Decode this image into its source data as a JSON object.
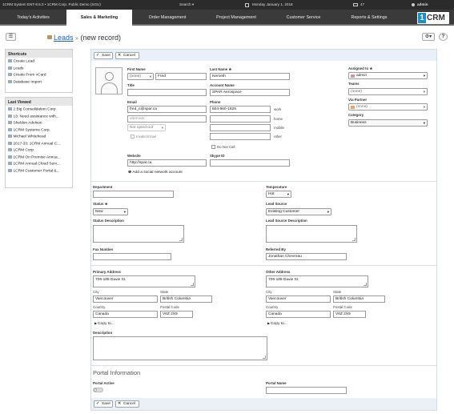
{
  "topbar": {
    "system": "1CRM System ENT-8.6.0 • 1CRM Corp. Public Demo (SGU)",
    "search": "Search ▾",
    "date": "Monday January 1, 2018",
    "mail_count": "47",
    "user": "admin"
  },
  "nav": {
    "tabs": [
      "Today's Activities",
      "Sales & Marketing",
      "Order Management",
      "Project Management",
      "Customer Service",
      "Reports & Settings"
    ],
    "logo_one": "1",
    "logo_crm": "CRM"
  },
  "breadcrumb": {
    "module": "Leads",
    "sep": "»",
    "record": "(new record)"
  },
  "sidebar": {
    "shortcuts_title": "Shortcuts",
    "shortcuts": [
      "Create Lead",
      "Leads",
      "Create From vCard",
      "Database Import"
    ],
    "viewed_title": "Last Viewed",
    "viewed": [
      "2 Big Consolidation Corp",
      "13: Need assistance with...",
      "Sheldon Adelson",
      "1CRM Systems Corp.",
      "Michael Whitehead",
      "2017-33: 1CRM Annual C...",
      "1CRM Corp",
      "1CRM On Premise Annua...",
      "1CRM Annual Cloud Serv...",
      "1CRM Customer Portal &..."
    ]
  },
  "buttons": {
    "save": "Save",
    "cancel": "Cancel"
  },
  "form": {
    "first_name_label": "First Name",
    "salutation": "(none)",
    "first_name": "Fred",
    "last_name_label": "Last Name ★",
    "last_name": "Nemeth",
    "title_label": "Title",
    "title": "",
    "account_label": "Account Name",
    "account": "SPAR Aerospace",
    "email_label": "Email",
    "email": "fred_n@spar.ca",
    "email_alt_placeholder": "alternate",
    "opt_out": "Not opted-out",
    "invalid_email": "Invalid Email",
    "phone_label": "Phone",
    "phone": "604-960-1828",
    "phone_types": [
      "work",
      "home",
      "mobile",
      "other"
    ],
    "do_not_call": "Do Not Call",
    "website_label": "Website",
    "website": "http://spar.ca",
    "skype_label": "Skype ID",
    "skype": "",
    "add_social": "Add a social network account",
    "assigned_label": "Assigned to ★",
    "assigned": "admin",
    "teams_label": "Teams",
    "teams": "(none)",
    "via_partner_label": "Via Partner",
    "via_partner": "(none)",
    "category_label": "Category",
    "category": "Business",
    "department_label": "Department",
    "department": "",
    "temperature_label": "Temperature",
    "temperature": "Hot",
    "status_label": "Status ★",
    "status": "New",
    "lead_source_label": "Lead Source",
    "lead_source": "Existing Customer",
    "status_desc_label": "Status Description",
    "lead_source_desc_label": "Lead Source Description",
    "fax_label": "Fax Number",
    "fax": "",
    "referred_label": "Referred By",
    "referred": "Jonathan Chevreau",
    "primary_address_label": "Primary Address",
    "primary_street": "706-189 Davie St.",
    "other_address_label": "Other Address",
    "other_street": "706-189 Davie St.",
    "city_label": "City",
    "state_label": "State",
    "country_label": "Country",
    "postal_label": "Postal Code",
    "primary_city": "Vancouver",
    "primary_state": "British Columbia",
    "primary_country": "Canada",
    "primary_postal": "V6Z 2X9",
    "other_city": "Vancouver",
    "other_state": "British Columbia",
    "other_country": "Canada",
    "other_postal": "V6Z 2X9",
    "copy_to": "Copy to...",
    "description_label": "Description",
    "portal_heading": "Portal Information",
    "portal_active_label": "Portal Active",
    "portal_name_label": "Portal Name",
    "portal_name": ""
  },
  "colors": {
    "topbar": "#2b2b2b",
    "navbar": "#3a3a3a",
    "brand_blue": "#1b8fc8",
    "link": "#1a64b8",
    "band": "#e9f0f7"
  }
}
